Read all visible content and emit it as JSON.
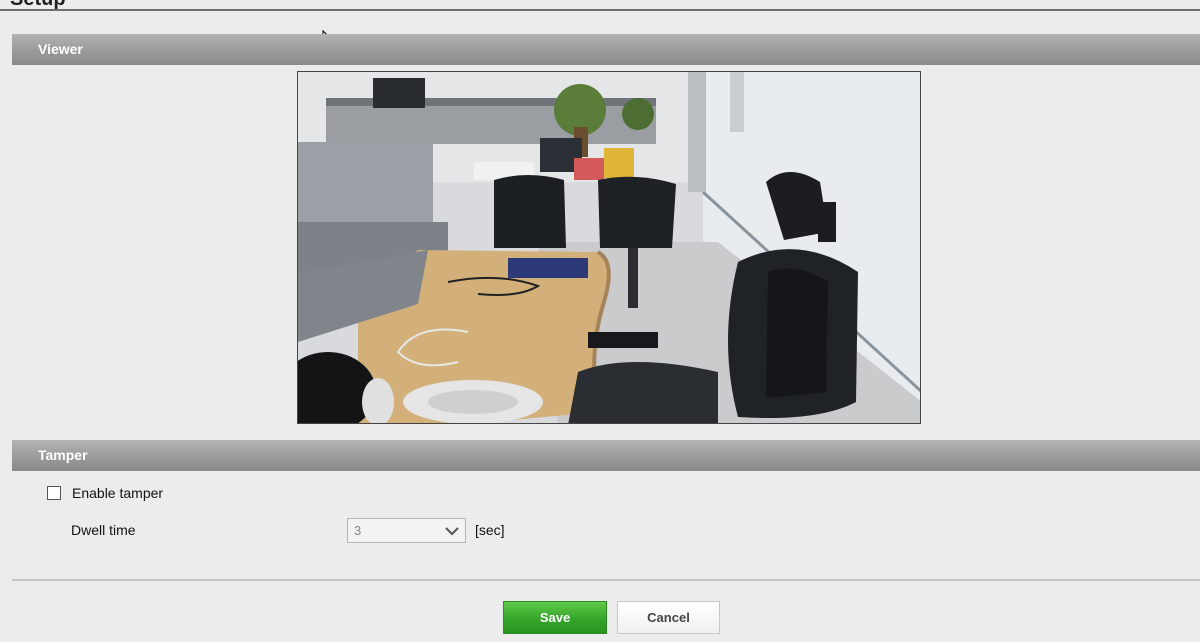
{
  "page": {
    "title": "Setup"
  },
  "viewer": {
    "section_title": "Viewer"
  },
  "tamper": {
    "section_title": "Tamper",
    "enable_label": "Enable tamper",
    "enable_checked": false,
    "dwell_label": "Dwell time",
    "dwell_value": "3",
    "dwell_unit": "[sec]"
  },
  "actions": {
    "save_label": "Save",
    "cancel_label": "Cancel"
  },
  "colors": {
    "section_bar": "#9a9a9a",
    "save_button": "#35a62a",
    "background": "#ececec"
  }
}
